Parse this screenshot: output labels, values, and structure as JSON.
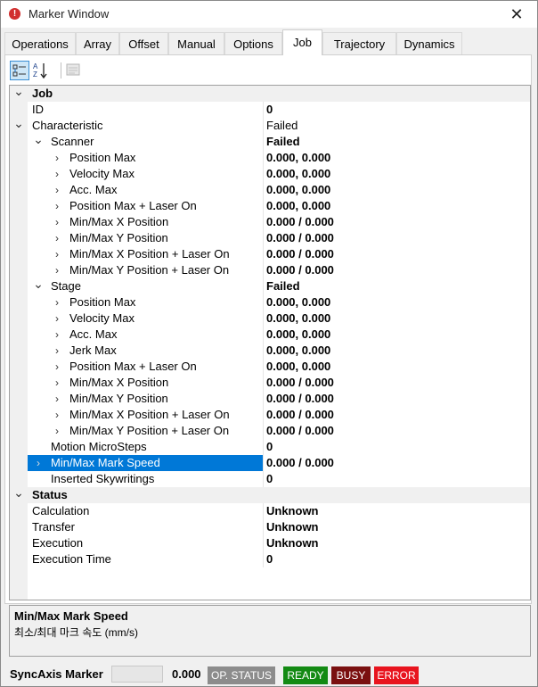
{
  "window": {
    "title": "Marker Window",
    "close_glyph": "✕",
    "icon_glyph": "!"
  },
  "tabs": [
    {
      "label": "Operations"
    },
    {
      "label": "Array"
    },
    {
      "label": "Offset"
    },
    {
      "label": "Manual"
    },
    {
      "label": "Options"
    },
    {
      "label": "Job",
      "active": true
    },
    {
      "label": "Trajectory"
    },
    {
      "label": "Dynamics"
    }
  ],
  "toolbar": {
    "categorized_icon": "categorized-icon",
    "alphabetical_icon": "sort-alphabetical-icon",
    "property_pages_icon": "property-pages-icon"
  },
  "properties": [
    {
      "name": "Job",
      "value": "",
      "level": 0,
      "category": true,
      "expander": "expanded"
    },
    {
      "name": "ID",
      "value": "0",
      "level": 1,
      "bold": true
    },
    {
      "name": "Characteristic",
      "value": "Failed",
      "level": 1,
      "expander": "expanded"
    },
    {
      "name": "Scanner",
      "value": "Failed",
      "level": 2,
      "bold": true,
      "expander": "expanded"
    },
    {
      "name": "Position Max",
      "value": "0.000, 0.000",
      "level": 3,
      "bold": true,
      "expander": "collapsed"
    },
    {
      "name": "Velocity Max",
      "value": "0.000, 0.000",
      "level": 3,
      "bold": true,
      "expander": "collapsed"
    },
    {
      "name": "Acc. Max",
      "value": "0.000, 0.000",
      "level": 3,
      "bold": true,
      "expander": "collapsed"
    },
    {
      "name": "Position Max + Laser On",
      "value": "0.000, 0.000",
      "level": 3,
      "bold": true,
      "expander": "collapsed"
    },
    {
      "name": "Min/Max X Position",
      "value": "0.000 / 0.000",
      "level": 3,
      "bold": true,
      "expander": "collapsed"
    },
    {
      "name": "Min/Max Y Position",
      "value": "0.000 / 0.000",
      "level": 3,
      "bold": true,
      "expander": "collapsed"
    },
    {
      "name": "Min/Max X Position + Laser On",
      "value": "0.000 / 0.000",
      "level": 3,
      "bold": true,
      "expander": "collapsed"
    },
    {
      "name": "Min/Max Y Position + Laser On",
      "value": "0.000 / 0.000",
      "level": 3,
      "bold": true,
      "expander": "collapsed"
    },
    {
      "name": "Stage",
      "value": "Failed",
      "level": 2,
      "bold": true,
      "expander": "expanded"
    },
    {
      "name": "Position Max",
      "value": "0.000, 0.000",
      "level": 3,
      "bold": true,
      "expander": "collapsed"
    },
    {
      "name": "Velocity Max",
      "value": "0.000, 0.000",
      "level": 3,
      "bold": true,
      "expander": "collapsed"
    },
    {
      "name": "Acc. Max",
      "value": "0.000, 0.000",
      "level": 3,
      "bold": true,
      "expander": "collapsed"
    },
    {
      "name": "Jerk Max",
      "value": "0.000, 0.000",
      "level": 3,
      "bold": true,
      "expander": "collapsed"
    },
    {
      "name": "Position Max + Laser On",
      "value": "0.000, 0.000",
      "level": 3,
      "bold": true,
      "expander": "collapsed"
    },
    {
      "name": "Min/Max X Position",
      "value": "0.000 / 0.000",
      "level": 3,
      "bold": true,
      "expander": "collapsed"
    },
    {
      "name": "Min/Max Y Position",
      "value": "0.000 / 0.000",
      "level": 3,
      "bold": true,
      "expander": "collapsed"
    },
    {
      "name": "Min/Max X Position + Laser On",
      "value": "0.000 / 0.000",
      "level": 3,
      "bold": true,
      "expander": "collapsed"
    },
    {
      "name": "Min/Max Y Position + Laser On",
      "value": "0.000 / 0.000",
      "level": 3,
      "bold": true,
      "expander": "collapsed"
    },
    {
      "name": "Motion MicroSteps",
      "value": "0",
      "level": 2,
      "bold": true
    },
    {
      "name": "Min/Max Mark Speed",
      "value": "0.000 / 0.000",
      "level": 2,
      "bold": true,
      "expander": "collapsed",
      "selected": true
    },
    {
      "name": "Inserted Skywritings",
      "value": "0",
      "level": 2,
      "bold": true
    },
    {
      "name": "Status",
      "value": "",
      "level": 0,
      "category": true,
      "expander": "expanded"
    },
    {
      "name": "Calculation",
      "value": "Unknown",
      "level": 1,
      "bold": true
    },
    {
      "name": "Transfer",
      "value": "Unknown",
      "level": 1,
      "bold": true
    },
    {
      "name": "Execution",
      "value": "Unknown",
      "level": 1,
      "bold": true
    },
    {
      "name": "Execution Time",
      "value": "0",
      "level": 1,
      "bold": true
    }
  ],
  "description": {
    "title": "Min/Max Mark Speed",
    "text": "최소/최대 마크 속도 (mm/s)"
  },
  "statusbar": {
    "label": "SyncAxis Marker",
    "value": "0.000",
    "badges": [
      {
        "label": "OP. STATUS",
        "color": "#8c8c8c"
      },
      {
        "label": "READY",
        "color": "#138a13"
      },
      {
        "label": "BUSY",
        "color": "#7a1010"
      },
      {
        "label": "ERROR",
        "color": "#e8141e"
      }
    ]
  },
  "colors": {
    "selection": "#0078d7",
    "category_bg": "#f0f0f0"
  }
}
